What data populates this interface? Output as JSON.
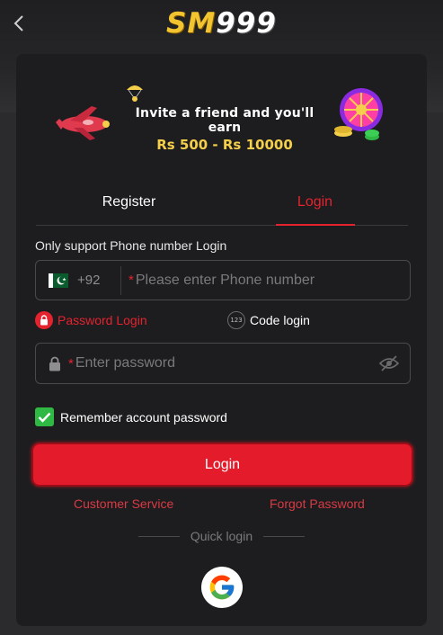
{
  "header": {
    "logo_sm": "SM",
    "logo_num": "999"
  },
  "banner": {
    "line1": "Invite a friend and you'll earn",
    "line2": "Rs 500 - Rs 10000"
  },
  "tabs": [
    {
      "label": "Register",
      "active": false
    },
    {
      "label": "Login",
      "active": true
    }
  ],
  "form": {
    "support_note": "Only support Phone number Login",
    "country_code": "+92",
    "required_mark": "*",
    "phone_placeholder": "Please enter Phone number",
    "mode_password": "Password Login",
    "mode_code": "Code login",
    "code_icon_text": "123",
    "password_placeholder": "Enter password",
    "remember_label": "Remember account password",
    "remember_checked": true,
    "login_button": "Login"
  },
  "links": {
    "customer_service": "Customer Service",
    "forgot_password": "Forgot Password"
  },
  "quick_login": {
    "label": "Quick login",
    "providers": [
      "google-icon"
    ]
  },
  "colors": {
    "accent": "#e4232f",
    "check": "#2fb844",
    "background": "#2b2b2d",
    "card": "#1d1d1f"
  }
}
